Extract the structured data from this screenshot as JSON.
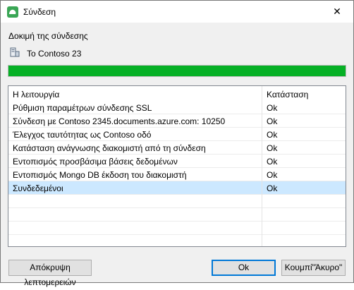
{
  "window": {
    "title": "Σύνδεση",
    "close_glyph": "✕"
  },
  "section": {
    "label": "Δοκιμή της σύνδεσης"
  },
  "server": {
    "name": "Το Contoso 23"
  },
  "progress": {
    "percent": 100,
    "color": "#06b025"
  },
  "grid": {
    "headers": {
      "operation": "Η λειτουργία",
      "status": "Κατάσταση"
    },
    "rows": [
      {
        "operation": "Ρύθμιση παραμέτρων σύνδεσης SSL",
        "status": "Ok"
      },
      {
        "operation": "Σύνδεση με Contoso 2345.documents.azure.com: 10250",
        "status": "Ok"
      },
      {
        "operation": "Έλεγχος ταυτότητας ως Contoso οδό",
        "status": "Ok"
      },
      {
        "operation": "Κατάσταση ανάγνωσης διακομιστή από τη σύνδεση",
        "status": "Ok"
      },
      {
        "operation": "Εντοπισμός προσβάσιμα βάσεις δεδομένων",
        "status": "Ok"
      },
      {
        "operation": "Εντοπισμός Mongo DB έκδοση του διακομιστή",
        "status": "Ok"
      },
      {
        "operation": "Συνδεδεμένοι",
        "status": "Ok"
      }
    ],
    "selected_row": 6
  },
  "buttons": {
    "hide_details": "Απόκρυψη λεπτομερειών",
    "ok": "Ok",
    "cancel": "Κουμπί\"Άκυρο\""
  },
  "colors": {
    "accent": "#0078d7",
    "selection": "#cce8ff",
    "app_icon": "#3aa655"
  }
}
